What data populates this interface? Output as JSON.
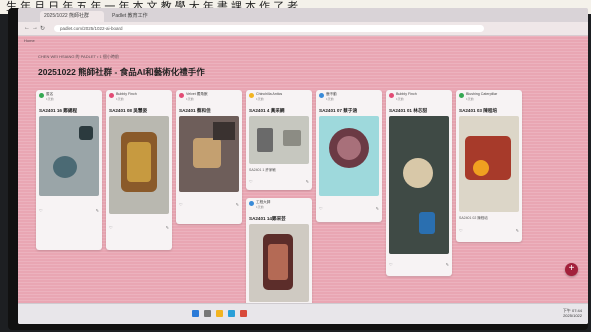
{
  "caption_text": "生 年 月 日 年 五 年 一 年 本 文 教 學 大 年 書 課 本 作 了 老",
  "browser": {
    "tabs": [
      "2025/1022 熊師社群",
      "Padlet 教育工作"
    ],
    "url": "padlet.com/2025/1022-ai-board",
    "icons": {
      "back": "back-arrow-icon",
      "forward": "forward-arrow-icon",
      "reload": "reload-icon"
    }
  },
  "board": {
    "breadcrumb": "CHEN WEI HSIANG 的 PADLET • 1 個小時前",
    "title": "20251022 熊師社群 - 食品AI和藝術化禮手作",
    "home_label": "Home",
    "bg_color": "#e9a6b3"
  },
  "columns": [
    {
      "author": "匿名",
      "time": "1天前",
      "title": "SA2401 16 鄭錫程",
      "avatar_color": "#35a853",
      "photo": {
        "bg": "#9aa5a8",
        "obj": "#4b6a74"
      },
      "caption": "",
      "likes": "",
      "comments": ""
    },
    {
      "author": "Bubbly Finch",
      "time": "1天前",
      "title": "SA2401 08 吳慧姿",
      "avatar_color": "#e24c75",
      "photo": {
        "bg": "#b9b8b0",
        "obj": "#8a5a2a"
      },
      "caption": "",
      "likes": "",
      "comments": ""
    },
    {
      "author": "Velvet 獨角獸",
      "time": "1天前",
      "title": "SA2401 蔡和佳",
      "avatar_color": "#e24c75",
      "photo": {
        "bg": "#6e5e5a",
        "obj": "#c4a070"
      },
      "caption": "",
      "likes": "",
      "comments": ""
    },
    {
      "author": "Chinchilla Antics",
      "time": "1天前",
      "title": "SA2401 4 黃采鋼",
      "avatar_color": "#f2b420",
      "photo": {
        "bg": "#c6c7bf",
        "obj": "#6a6a6a"
      },
      "caption": "SA2401 1 許家敏",
      "likes": "",
      "comments": ""
    },
    {
      "author": "鹿不動",
      "time": "1天前",
      "title": "SA2401 07 蔡于涵",
      "avatar_color": "#3a8bd8",
      "photo": {
        "bg": "#9ed9dc",
        "obj": "#6b3a44"
      },
      "caption": "",
      "likes": "",
      "comments": ""
    },
    {
      "author": "Bubbly Finch",
      "time": "1天前",
      "title": "SA2401 01 林芯甜",
      "avatar_color": "#e24c75",
      "photo": {
        "bg": "#3f4a45",
        "obj": "#d8c8a8"
      },
      "caption": "",
      "likes": "",
      "comments": ""
    },
    {
      "author": "Blushing Caterpillar",
      "time": "1天前",
      "title": "SA2401 03 陳程培",
      "avatar_color": "#35a853",
      "photo": {
        "bg": "#dcd6c8",
        "obj": "#a73a2a"
      },
      "caption": "SA2401 02 陳程培",
      "likes": "",
      "comments": ""
    }
  ],
  "extra_card": {
    "author": "工程大師",
    "time": "1天前",
    "title": "SA2401 14鄭采芸",
    "avatar_color": "#3a8bd8",
    "photo": {
      "bg": "#cfcac2",
      "obj": "#5c2d2a"
    }
  },
  "fab_label": "+",
  "taskbar": {
    "time": "下午 07:44",
    "date": "2025/1022"
  }
}
